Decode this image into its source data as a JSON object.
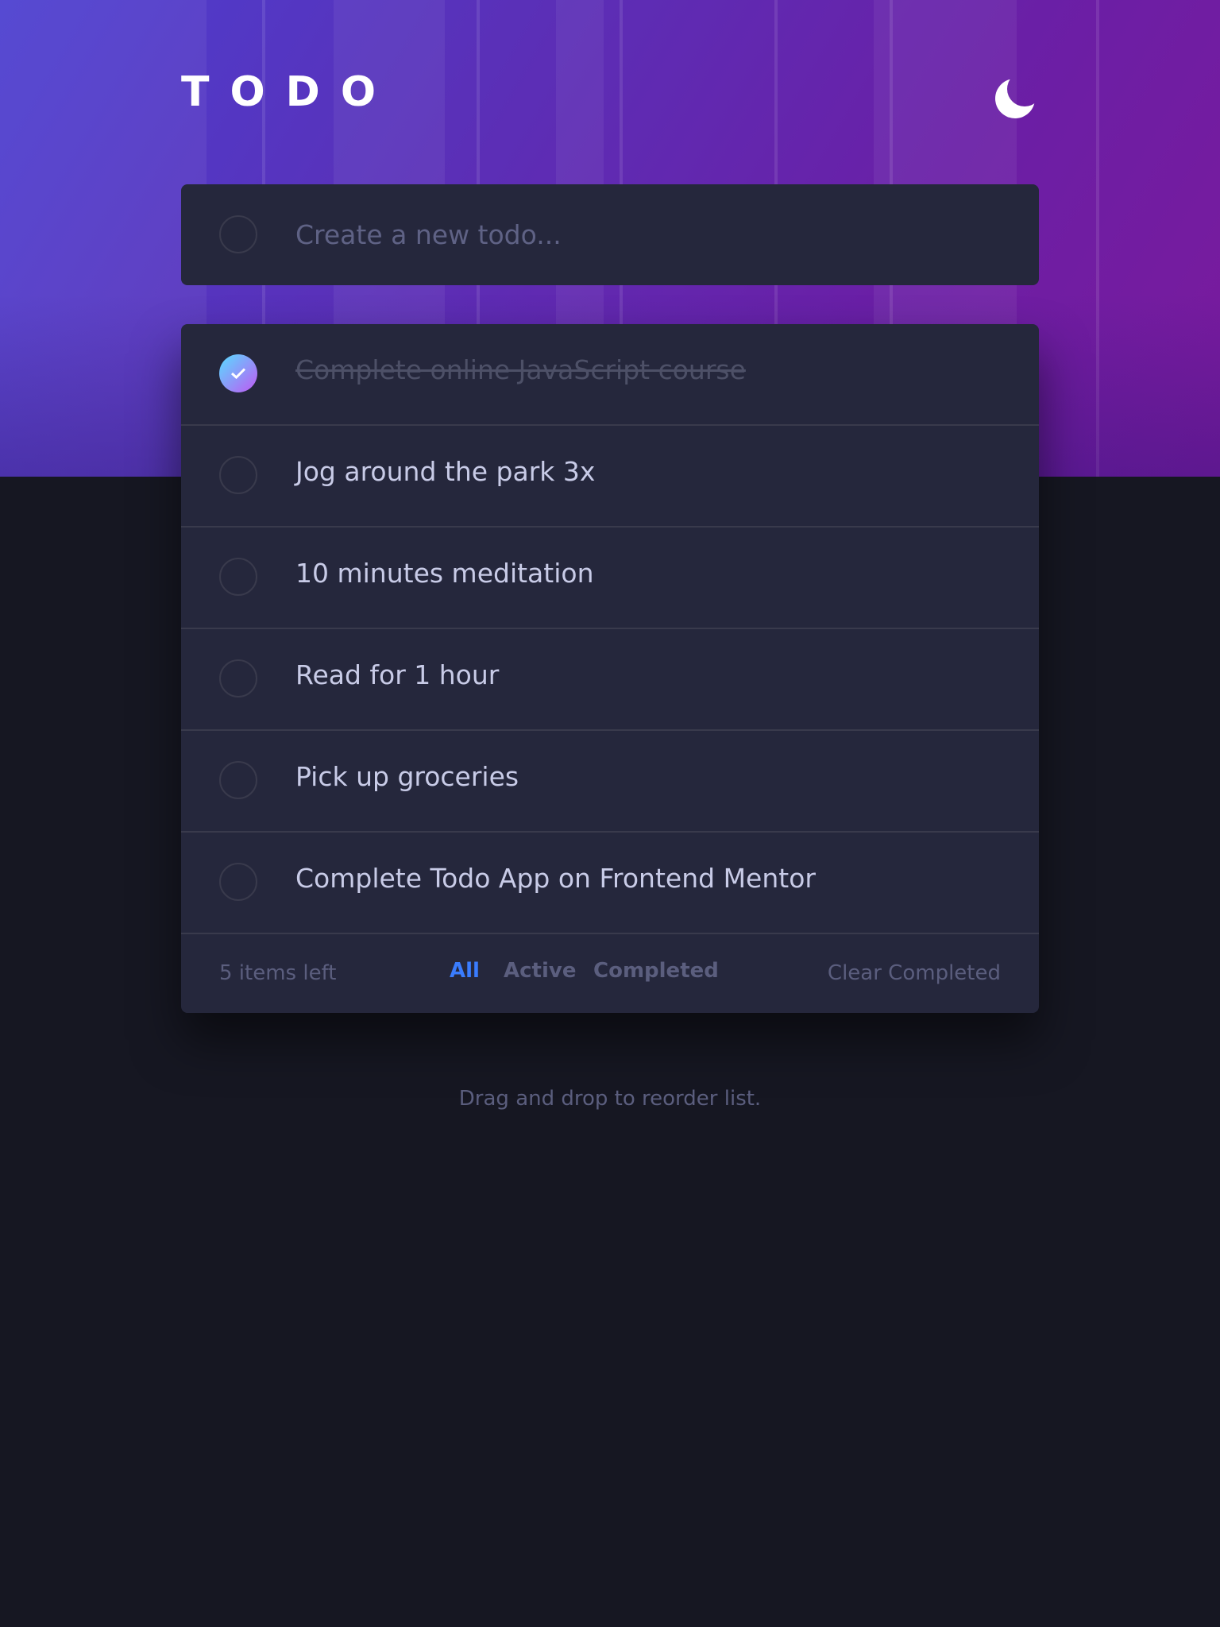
{
  "header": {
    "title": "TODO",
    "theme_toggle_icon": "moon-icon"
  },
  "new_todo": {
    "placeholder": "Create a new todo..."
  },
  "todos": [
    {
      "text": "Complete online JavaScript course",
      "completed": true
    },
    {
      "text": "Jog around the park 3x",
      "completed": false
    },
    {
      "text": "10 minutes meditation",
      "completed": false
    },
    {
      "text": "Read for 1 hour",
      "completed": false
    },
    {
      "text": "Pick up groceries",
      "completed": false
    },
    {
      "text": "Complete Todo App on Frontend Mentor",
      "completed": false
    }
  ],
  "footer": {
    "items_left": "5 items left",
    "filters": [
      "All",
      "Active",
      "Completed"
    ],
    "active_filter": "All",
    "clear_label": "Clear Completed"
  },
  "hint": "Drag and drop to reorder list.",
  "colors": {
    "accent": "#3a7cfd",
    "check_gradient_start": "#57ddff",
    "check_gradient_end": "#c058f3",
    "card": "#25273c",
    "background": "#161722"
  }
}
